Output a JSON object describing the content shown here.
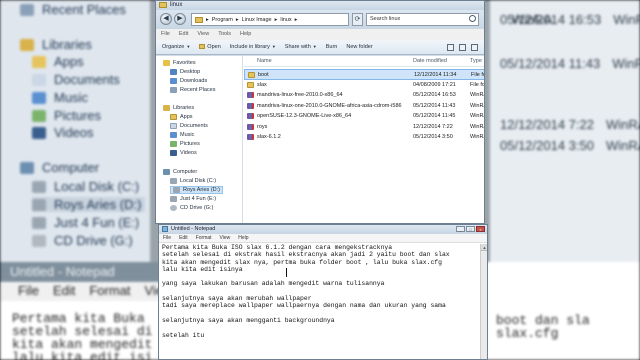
{
  "background": {
    "sidebar": [
      {
        "label": "Recent Places",
        "icon": "recent-places-icon",
        "color": "#8aa0b8"
      },
      {
        "label": "Libraries",
        "icon": "libraries-icon",
        "color": "#d8b24a"
      },
      {
        "label": "Apps",
        "icon": "folder-icon",
        "color": "#e6c45d"
      },
      {
        "label": "Documents",
        "icon": "documents-icon",
        "color": "#c9d7e6"
      },
      {
        "label": "Music",
        "icon": "music-icon",
        "color": "#5a8fd0"
      },
      {
        "label": "Pictures",
        "icon": "pictures-icon",
        "color": "#7bb36d"
      },
      {
        "label": "Videos",
        "icon": "videos-icon",
        "color": "#3a5f8f"
      },
      {
        "label": "Computer",
        "icon": "computer-icon",
        "color": "#6d8fb0"
      },
      {
        "label": "Local Disk (C:)",
        "icon": "drive-icon",
        "color": "#9aa6b2"
      },
      {
        "label": "Roys Aries (D:)",
        "icon": "drive-icon",
        "color": "#9aa6b2"
      },
      {
        "label": "Just 4 Fun (E:)",
        "icon": "drive-icon",
        "color": "#9aa6b2"
      },
      {
        "label": "CD Drive (G:)",
        "icon": "cd-drive-icon",
        "color": "#b0b8c0"
      }
    ],
    "dates": [
      {
        "date": "",
        "type": "WinRA"
      },
      {
        "date": "05/12/2014 16:53",
        "type": "WinRA"
      },
      {
        "date": "05/12/2014 11:43",
        "type": "WinRA"
      },
      {
        "date": "12/12/2014 7:22",
        "type": "WinRA"
      },
      {
        "date": "05/12/2014 3:50",
        "type": "WinRA"
      }
    ],
    "notepad_title": "Untitled - Notepad",
    "notepad_menu": [
      "File",
      "Edit",
      "Format",
      "View",
      "Help"
    ],
    "notepad_text": "Pertama kita Buka\nsetelah selesai di\nkita akan mengedit\nlalu kita edit isi",
    "notepad_text_right": "boot dan sla\nslax.cfg"
  },
  "explorer": {
    "title": "linux",
    "address": [
      "Program",
      "Linux Image",
      "linux"
    ],
    "search_placeholder": "Search linux",
    "menu": [
      "File",
      "Edit",
      "View",
      "Tools",
      "Help"
    ],
    "toolbar": {
      "organize": "Organize",
      "open": "Open",
      "include": "Include in library",
      "share": "Share with",
      "burn": "Burn",
      "new_folder": "New folder"
    },
    "nav": {
      "favorites": "Favorites",
      "desktop": "Desktop",
      "downloads": "Downloads",
      "recent": "Recent Places",
      "libraries": "Libraries",
      "apps": "Apps",
      "documents": "Documents",
      "music": "Music",
      "pictures": "Pictures",
      "videos": "Videos",
      "computer": "Computer",
      "local_disk": "Local Disk (C:)",
      "roys_aries": "Roys Aries (D:)",
      "just4fun": "Just 4 Fun (E:)",
      "cd_drive": "CD Drive (G:)"
    },
    "columns": {
      "name": "Name",
      "date": "Date modified",
      "type": "Type"
    },
    "files": [
      {
        "name": "boot",
        "date": "12/12/2014 11:34",
        "type": "File fol",
        "icon": "folder-icon",
        "selected": true
      },
      {
        "name": "slax",
        "date": "04/08/2009 17:21",
        "type": "File fol",
        "icon": "folder-icon",
        "selected": false
      },
      {
        "name": "mandriva-linux-free-2010.0-x86_64",
        "date": "05/12/2014 16:53",
        "type": "WinRA",
        "icon": "rar-icon",
        "selected": false
      },
      {
        "name": "mandriva-linux-one-2010.0-GNOME-africa-asia-cdrom-i586",
        "date": "05/12/2014 11:43",
        "type": "WinRA",
        "icon": "rar-icon",
        "selected": false
      },
      {
        "name": "openSUSE-12.3-GNOME-Live-x86_64",
        "date": "05/12/2014 11:45",
        "type": "WinRA",
        "icon": "rar-icon",
        "selected": false
      },
      {
        "name": "roys",
        "date": "12/12/2014 7:22",
        "type": "WinRA",
        "icon": "rar-icon",
        "selected": false
      },
      {
        "name": "slax-6.1.2",
        "date": "05/12/2014 3:50",
        "type": "WinRA",
        "icon": "rar-icon",
        "selected": false
      }
    ]
  },
  "notepad": {
    "title": "Untitled - Notepad",
    "menu": [
      "File",
      "Edit",
      "Format",
      "View",
      "Help"
    ],
    "lines": [
      "Pertama kita Buka ISO slax 6.1.2 dengan cara mengekstracknya",
      "setelah selesai di ekstrak hasil ekstracnya akan jadi 2 yaitu boot dan slax",
      "kita akan mengedit slax nya, pertma buka folder boot , lalu buka slax.cfg",
      "lalu kita edit isinya",
      "",
      "yang saya lakukan barusan adalah mengedit warna tulisannya",
      "",
      "selanjutnya saya akan merubah wallpaper",
      "tadi saya mereplace wallpaper wallpaernya dengan nama dan ukuran yang sama",
      "",
      "selanjutnya saya akan mengganti backgroundnya",
      "",
      "setelah itu"
    ]
  }
}
